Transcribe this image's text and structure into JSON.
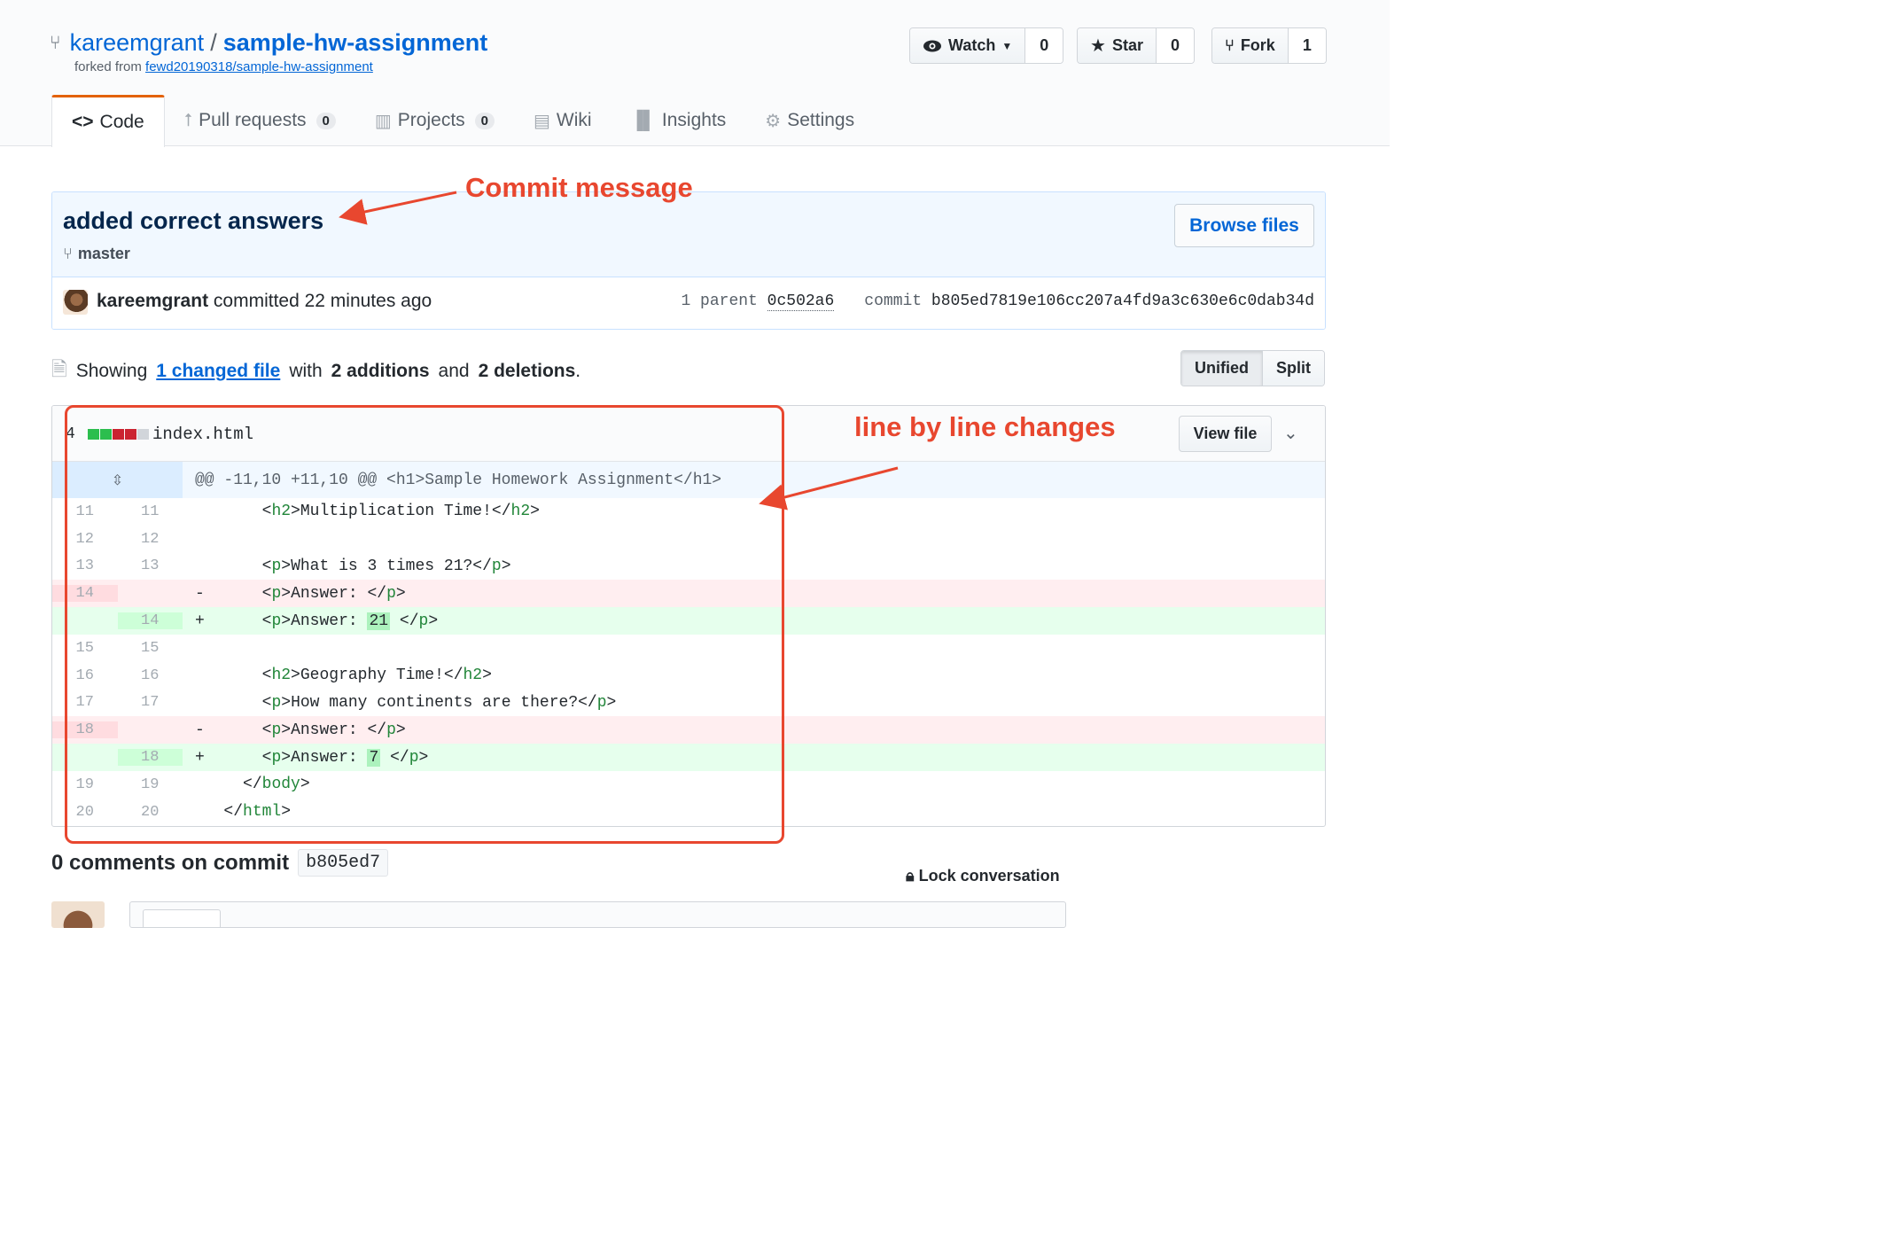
{
  "repo": {
    "owner": "kareemgrant",
    "separator": "/",
    "name": "sample-hw-assignment",
    "forked_prefix": "forked from ",
    "forked_link": "fewd20190318/sample-hw-assignment"
  },
  "actions": {
    "watch": {
      "label": "Watch",
      "count": "0"
    },
    "star": {
      "label": "Star",
      "count": "0"
    },
    "fork": {
      "label": "Fork",
      "count": "1"
    }
  },
  "tabs": [
    {
      "label": "Code",
      "icon": "code-icon"
    },
    {
      "label": "Pull requests",
      "badge": "0",
      "icon": "pull-request-icon"
    },
    {
      "label": "Projects",
      "badge": "0",
      "icon": "project-icon"
    },
    {
      "label": "Wiki",
      "icon": "book-icon"
    },
    {
      "label": "Insights",
      "icon": "graph-icon"
    },
    {
      "label": "Settings",
      "icon": "gear-icon"
    }
  ],
  "commit": {
    "title": "added correct answers",
    "branch": "master",
    "browse_label": "Browse files",
    "author": "kareemgrant",
    "committed_text": " committed 22 minutes ago",
    "parent_label": "1 parent",
    "parent_sha": "0c502a6",
    "commit_label": "commit",
    "commit_sha": "b805ed7819e106cc207a4fd9a3c630e6c0dab34d"
  },
  "summary": {
    "showing": "Showing",
    "changed_link": "1 changed file",
    "with": "with",
    "additions": "2 additions",
    "and": "and",
    "deletions": "2 deletions",
    "period": "."
  },
  "view_toggle": {
    "unified": "Unified",
    "split": "Split"
  },
  "file": {
    "change_count": "4",
    "name": "index.html",
    "view_label": "View file",
    "hunk_header": "@@ -11,10 +11,10 @@ <h1>Sample Homework Assignment</h1>",
    "lines": [
      {
        "old": "11",
        "new": "11",
        "type": "ctx",
        "sign": " ",
        "indent": "      ",
        "tag": "h2",
        "text": "Multiplication Time!",
        "close": "h2"
      },
      {
        "old": "12",
        "new": "12",
        "type": "ctx",
        "sign": " ",
        "indent": "",
        "tag": "",
        "text": "",
        "close": ""
      },
      {
        "old": "13",
        "new": "13",
        "type": "ctx",
        "sign": " ",
        "indent": "      ",
        "tag": "p",
        "text": "What is 3 times 21?",
        "close": "p"
      },
      {
        "old": "14",
        "new": "",
        "type": "del",
        "sign": "-",
        "indent": "      ",
        "tag": "p",
        "text": "Answer: ",
        "close": "p"
      },
      {
        "old": "",
        "new": "14",
        "type": "add",
        "sign": "+",
        "indent": "      ",
        "tag": "p",
        "text": "Answer: ",
        "highlight": "21",
        "close": "p"
      },
      {
        "old": "15",
        "new": "15",
        "type": "ctx",
        "sign": " ",
        "indent": "",
        "tag": "",
        "text": "",
        "close": ""
      },
      {
        "old": "16",
        "new": "16",
        "type": "ctx",
        "sign": " ",
        "indent": "      ",
        "tag": "h2",
        "text": "Geography Time!",
        "close": "h2"
      },
      {
        "old": "17",
        "new": "17",
        "type": "ctx",
        "sign": " ",
        "indent": "      ",
        "tag": "p",
        "text": "How many continents are there?",
        "close": "p"
      },
      {
        "old": "18",
        "new": "",
        "type": "del",
        "sign": "-",
        "indent": "      ",
        "tag": "p",
        "text": "Answer: ",
        "close": "p"
      },
      {
        "old": "",
        "new": "18",
        "type": "add",
        "sign": "+",
        "indent": "      ",
        "tag": "p",
        "text": "Answer: ",
        "highlight": "7",
        "close": "p"
      },
      {
        "old": "19",
        "new": "19",
        "type": "ctx",
        "sign": " ",
        "indent": "    ",
        "tag": "",
        "text": "",
        "close": "body"
      },
      {
        "old": "20",
        "new": "20",
        "type": "ctx",
        "sign": " ",
        "indent": "  ",
        "tag": "",
        "text": "",
        "close": "html"
      }
    ]
  },
  "comments": {
    "title": "0 comments on commit",
    "sha": "b805ed7",
    "lock_label": "Lock conversation"
  },
  "annotations": {
    "commit_message": "Commit message",
    "line_changes": "line by line changes"
  },
  "colors": {
    "link": "#0366d6",
    "annotation": "#e8472f",
    "addition": "#2cbe4e",
    "deletion": "#cb2431",
    "tab_accent": "#e36209"
  }
}
